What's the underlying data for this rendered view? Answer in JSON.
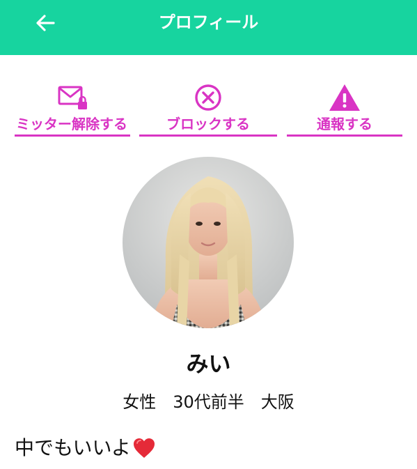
{
  "header": {
    "title": "プロフィール",
    "back_icon": "arrow-left-icon",
    "background_color": "#17d49f"
  },
  "actions": [
    {
      "label": "ミッター解除する",
      "icon": "mail-lock-icon"
    },
    {
      "label": "ブロックする",
      "icon": "block-circle-x-icon"
    },
    {
      "label": "通報する",
      "icon": "warning-triangle-icon"
    }
  ],
  "accent_color": "#d934c4",
  "profile": {
    "name": "みい",
    "meta": "女性　30代前半　大阪",
    "bio": "中でもいいよ",
    "bio_emoji": "heart-icon"
  }
}
